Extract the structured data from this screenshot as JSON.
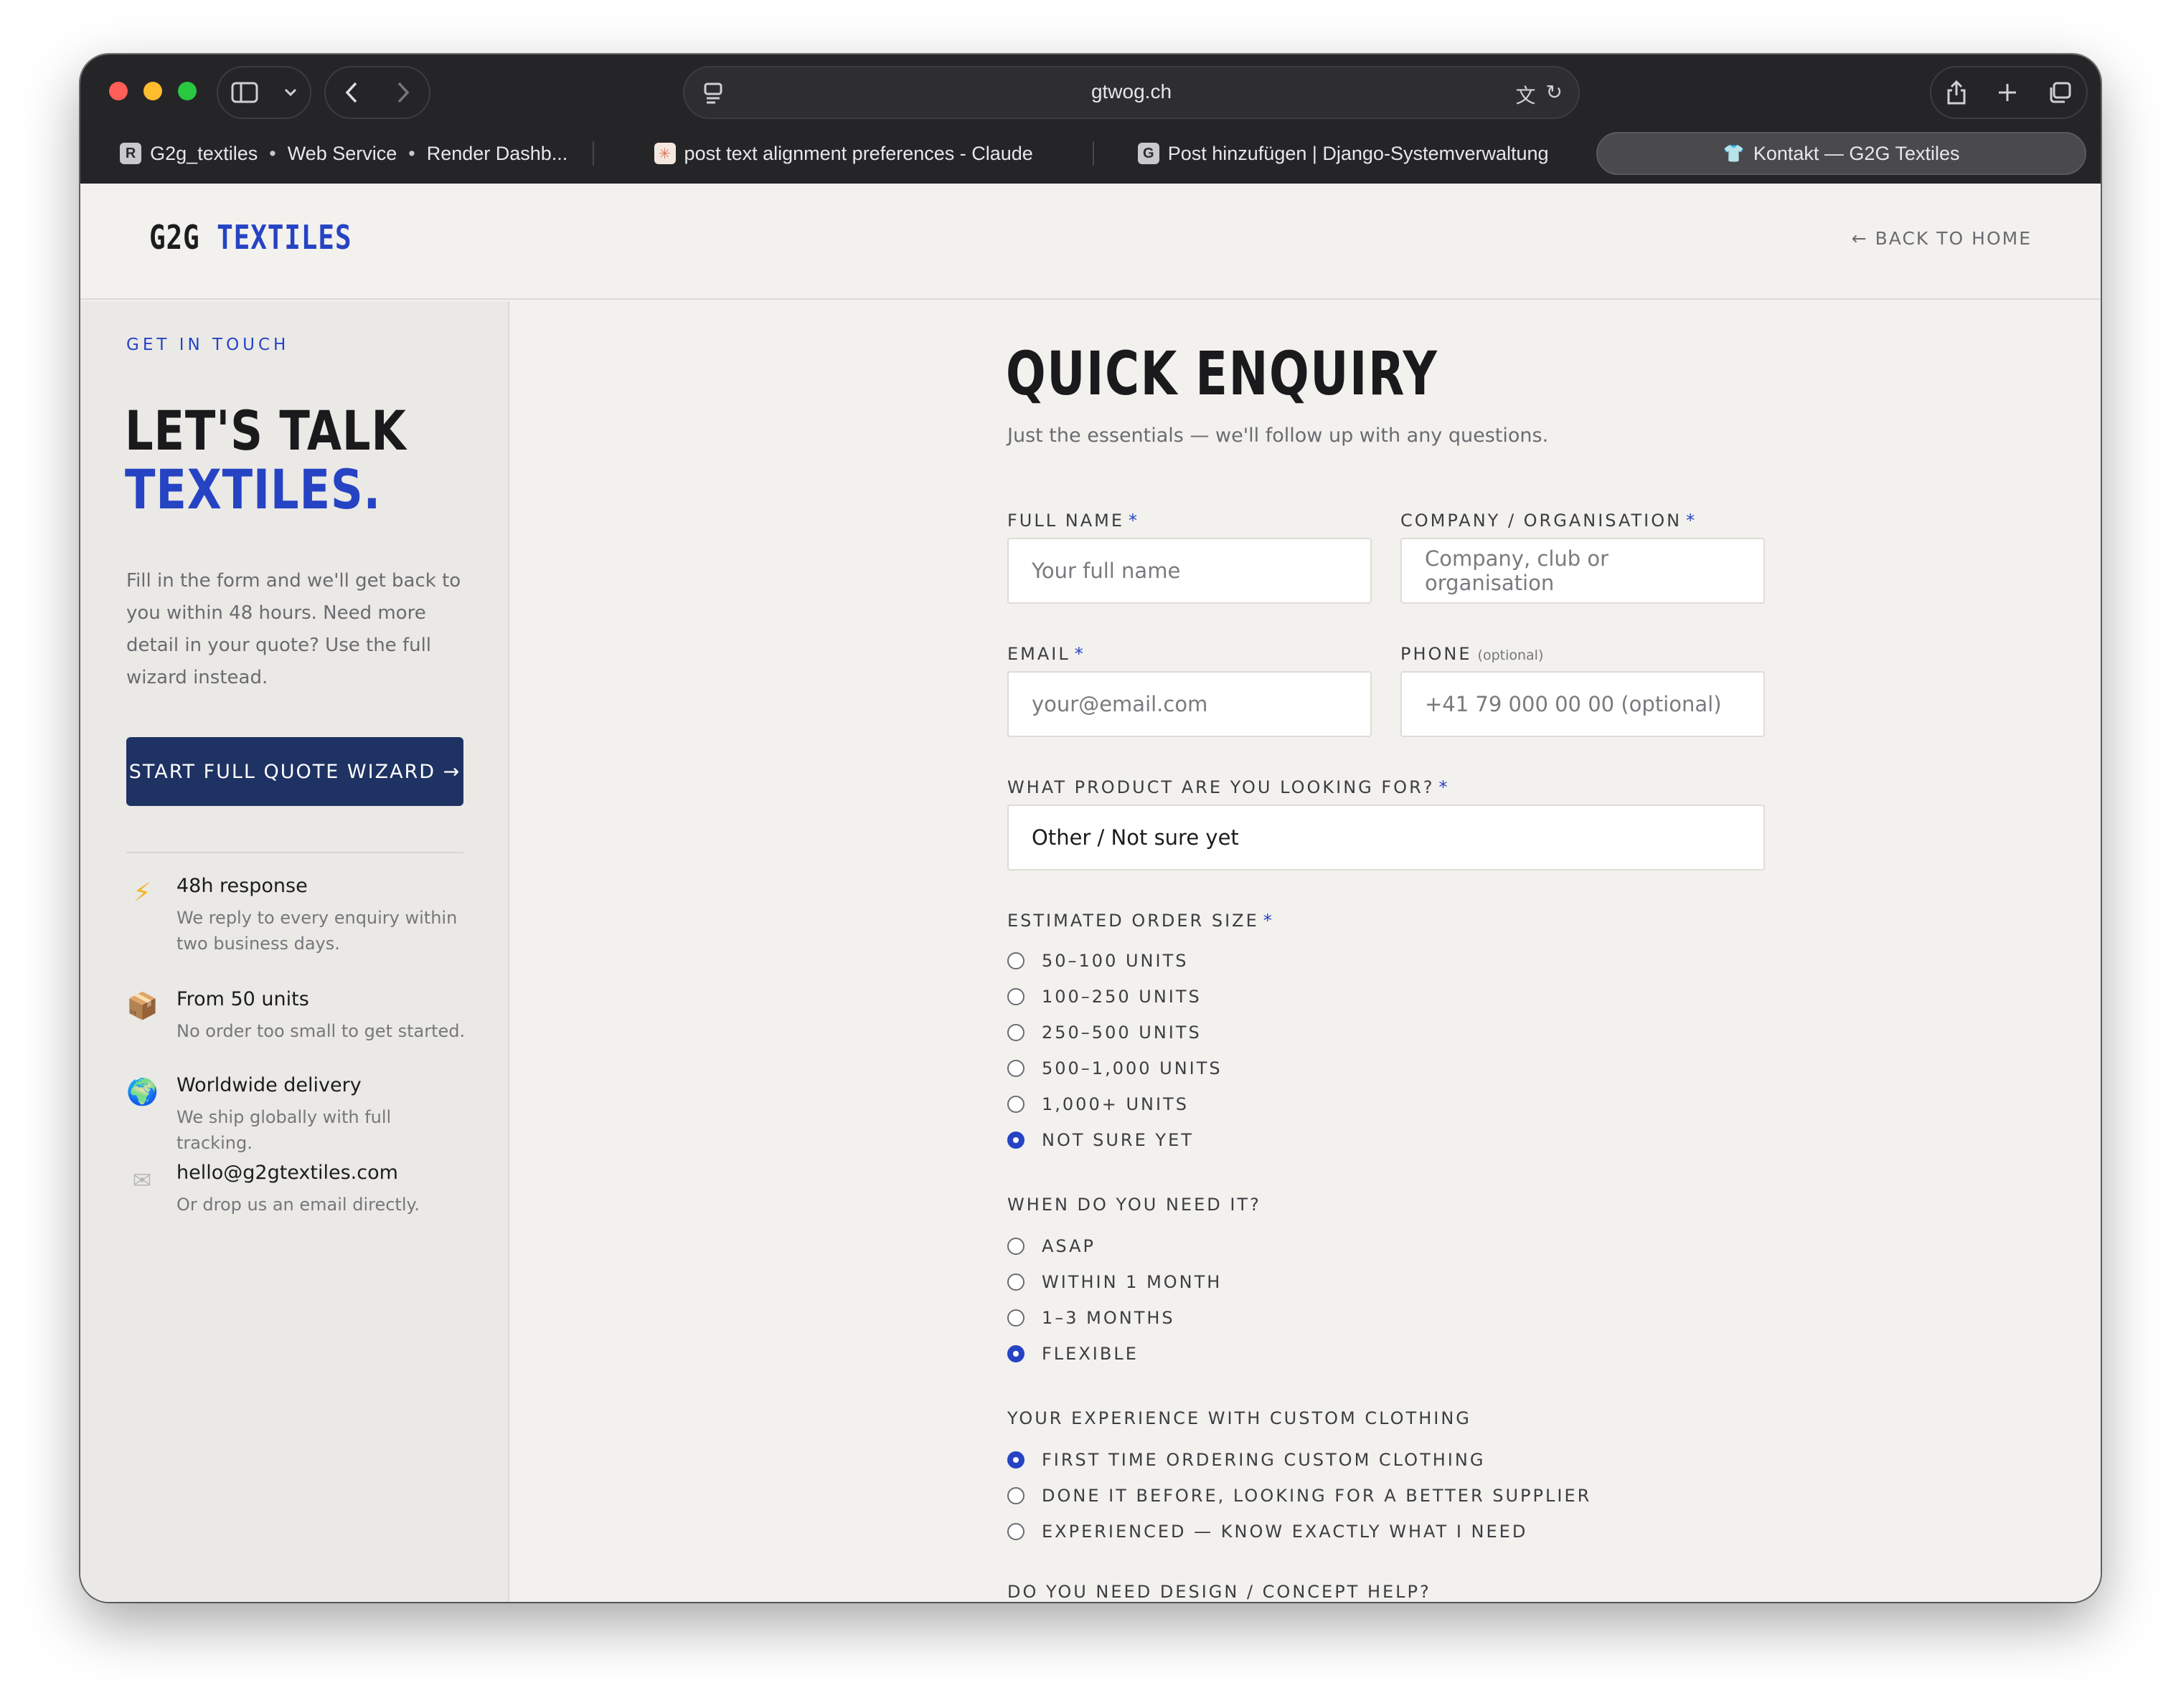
{
  "browser": {
    "url": "gtwog.ch",
    "tabs": [
      {
        "favicon": "R",
        "parts": [
          "G2g_textiles",
          "Web Service",
          "Render Dashb..."
        ]
      },
      {
        "favicon": "✳",
        "title": "post text alignment preferences - Claude"
      },
      {
        "favicon": "G",
        "title": "Post hinzufügen | Django-Systemverwaltung"
      },
      {
        "favicon": "👕",
        "title": "Kontakt — G2G Textiles"
      }
    ]
  },
  "header": {
    "logo_a": "G2G",
    "logo_b": "TEXTILES",
    "back_link": "← BACK TO HOME"
  },
  "sidebar": {
    "eyebrow": "GET IN TOUCH",
    "hero_line1": "LET'S TALK",
    "hero_line2": "TEXTILES.",
    "intro": "Fill in the form and we'll get back to you within 48 hours. Need more detail in your quote? Use the full wizard instead.",
    "wizard_button": "START FULL QUOTE WIZARD →",
    "features": [
      {
        "icon": "⚡",
        "icon_name": "lightning-icon",
        "title": "48h response",
        "desc": "We reply to every enquiry within two business days."
      },
      {
        "icon": "📦",
        "icon_name": "package-icon",
        "title": "From 50 units",
        "desc": "No order too small to get started."
      },
      {
        "icon": "🌍",
        "icon_name": "globe-icon",
        "title": "Worldwide delivery",
        "desc": "We ship globally with full tracking."
      },
      {
        "icon": "✉",
        "icon_name": "envelope-icon",
        "title": "hello@g2gtextiles.com",
        "desc": "Or drop us an email directly."
      }
    ]
  },
  "form": {
    "title": "QUICK ENQUIRY",
    "subtitle": "Just the essentials — we'll follow up with any questions.",
    "full_name": {
      "label": "FULL NAME",
      "placeholder": "Your full name"
    },
    "company": {
      "label": "COMPANY / ORGANISATION",
      "placeholder": "Company, club or organisation"
    },
    "email": {
      "label": "EMAIL",
      "placeholder": "your@email.com"
    },
    "phone": {
      "label": "PHONE",
      "optional": "(optional)",
      "placeholder": "+41 79 000 00 00 (optional)"
    },
    "product": {
      "label": "WHAT PRODUCT ARE YOU LOOKING FOR?",
      "value": "Other / Not sure yet"
    },
    "order_size": {
      "label": "ESTIMATED ORDER SIZE",
      "options": [
        "50–100 UNITS",
        "100–250 UNITS",
        "250–500 UNITS",
        "500–1,000 UNITS",
        "1,000+ UNITS",
        "NOT SURE YET"
      ],
      "selected": "NOT SURE YET"
    },
    "timing": {
      "label": "WHEN DO YOU NEED IT?",
      "options": [
        "ASAP",
        "WITHIN 1 MONTH",
        "1–3 MONTHS",
        "FLEXIBLE"
      ],
      "selected": "FLEXIBLE"
    },
    "experience": {
      "label": "YOUR EXPERIENCE WITH CUSTOM CLOTHING",
      "options": [
        "FIRST TIME ORDERING CUSTOM CLOTHING",
        "DONE IT BEFORE, LOOKING FOR A BETTER SUPPLIER",
        "EXPERIENCED — KNOW EXACTLY WHAT I NEED"
      ],
      "selected": "FIRST TIME ORDERING CUSTOM CLOTHING"
    },
    "design_help": {
      "label": "DO YOU NEED DESIGN / CONCEPT HELP?"
    },
    "required_mark": "*"
  },
  "colors": {
    "accent": "#2643c4",
    "button": "#1e3263",
    "page_bg": "#f2f1ee",
    "sidebar_bg": "#eae9e5"
  }
}
